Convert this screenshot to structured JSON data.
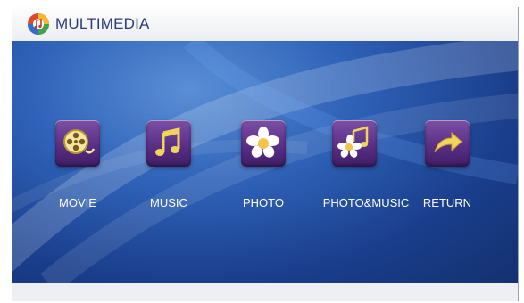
{
  "window": {
    "title": "MULTIMEDIA"
  },
  "menu": {
    "items": [
      {
        "label": "MOVIE",
        "icon": "film-reel-icon"
      },
      {
        "label": "MUSIC",
        "icon": "music-note-icon"
      },
      {
        "label": "PHOTO",
        "icon": "flower-icon"
      },
      {
        "label": "PHOTO&MUSIC",
        "icon": "flower-music-icon"
      },
      {
        "label": "RETURN",
        "icon": "return-arrow-icon"
      }
    ]
  },
  "colors": {
    "accent": "#2a3b78",
    "tile": "#5b2f86",
    "background": "#2f62b8"
  }
}
